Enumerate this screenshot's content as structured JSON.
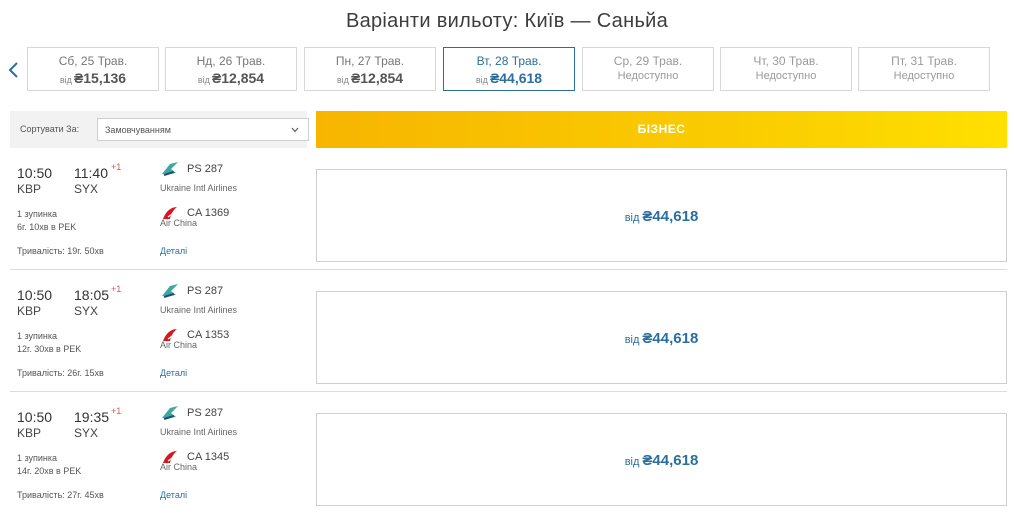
{
  "title": "Варіанти вильоту: Київ — Саньйа",
  "nav": {
    "prev_icon": "chevron-left-icon"
  },
  "dates": [
    {
      "day": "Сб, 25 Трав.",
      "from": "від",
      "price": "₴15,136",
      "state": "available"
    },
    {
      "day": "Нд, 26 Трав.",
      "from": "від",
      "price": "₴12,854",
      "state": "available"
    },
    {
      "day": "Пн, 27 Трав.",
      "from": "від",
      "price": "₴12,854",
      "state": "available"
    },
    {
      "day": "Вт, 28 Трав.",
      "from": "від",
      "price": "₴44,618",
      "state": "selected"
    },
    {
      "day": "Ср, 29 Трав.",
      "status": "Недоступно",
      "state": "unavailable"
    },
    {
      "day": "Чт, 30 Трав.",
      "status": "Недоступно",
      "state": "unavailable"
    },
    {
      "day": "Пт, 31 Трав.",
      "status": "Недоступно",
      "state": "unavailable"
    }
  ],
  "sort": {
    "label": "Сортувати За:",
    "value": "Замовчуванням"
  },
  "cabin": {
    "label": "БІЗНЕС"
  },
  "colors": {
    "accent": "#2a6f9e",
    "cabin_yellow": "#f7b500",
    "air_china_red": "#d7161e",
    "uia_green": "#3fa7a0"
  },
  "flights": [
    {
      "dep_time": "10:50",
      "arr_time": "11:40",
      "day_offset": "+1",
      "dep_code": "KBP",
      "arr_code": "SYX",
      "stops": "1 зупинка",
      "layover": "6г. 10хв в PEK",
      "duration": "Тривалість: 19г. 50хв",
      "segments": [
        {
          "flight_no": "PS 287",
          "airline": "Ukraine Intl Airlines",
          "logo": "uia-logo-icon"
        },
        {
          "flight_no": "CA 1369",
          "airline": "Air China",
          "logo": "air-china-logo-icon"
        }
      ],
      "details": "Деталі",
      "fare": {
        "from": "від",
        "price": "₴44,618"
      }
    },
    {
      "dep_time": "10:50",
      "arr_time": "18:05",
      "day_offset": "+1",
      "dep_code": "KBP",
      "arr_code": "SYX",
      "stops": "1 зупинка",
      "layover": "12г. 30хв в PEK",
      "duration": "Тривалість: 26г. 15хв",
      "segments": [
        {
          "flight_no": "PS 287",
          "airline": "Ukraine Intl Airlines",
          "logo": "uia-logo-icon"
        },
        {
          "flight_no": "CA 1353",
          "airline": "Air China",
          "logo": "air-china-logo-icon"
        }
      ],
      "details": "Деталі",
      "fare": {
        "from": "від",
        "price": "₴44,618"
      }
    },
    {
      "dep_time": "10:50",
      "arr_time": "19:35",
      "day_offset": "+1",
      "dep_code": "KBP",
      "arr_code": "SYX",
      "stops": "1 зупинка",
      "layover": "14г. 20хв в PEK",
      "duration": "Тривалість: 27г. 45хв",
      "segments": [
        {
          "flight_no": "PS 287",
          "airline": "Ukraine Intl Airlines",
          "logo": "uia-logo-icon"
        },
        {
          "flight_no": "CA 1345",
          "airline": "Air China",
          "logo": "air-china-logo-icon"
        }
      ],
      "details": "Деталі",
      "fare": {
        "from": "від",
        "price": "₴44,618"
      }
    }
  ]
}
